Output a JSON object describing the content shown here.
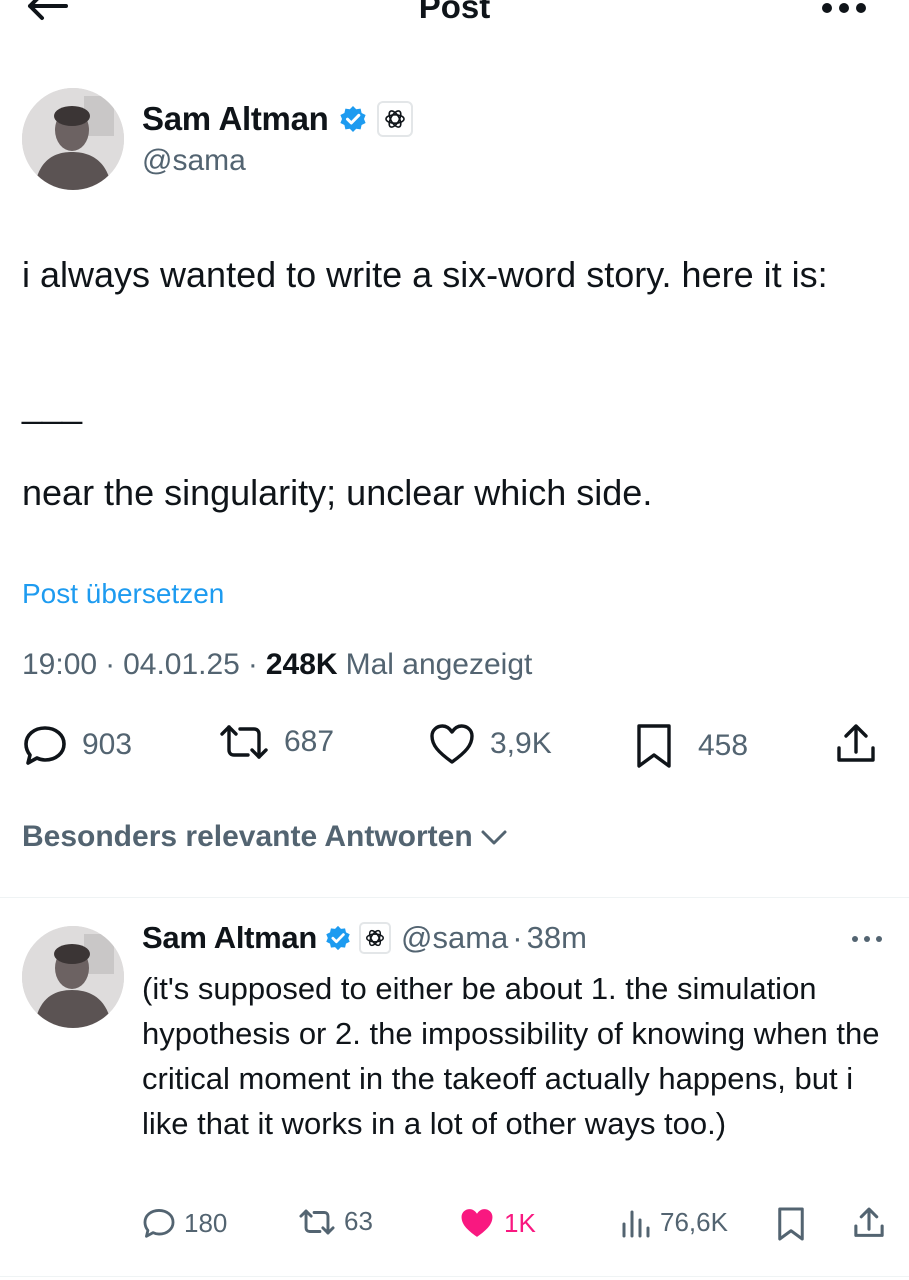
{
  "header": {
    "title": "Post",
    "back_icon": "arrow-left-icon",
    "more_icon": "more-horizontal-icon"
  },
  "post": {
    "author": {
      "name": "Sam Altman",
      "handle": "@sama",
      "verified_icon": "verified-badge-icon",
      "affiliation_icon": "openai-logo-icon"
    },
    "text_line1": "i always wanted to write a six-word story. here it is:",
    "text_line2": "___",
    "text_line3": "near the singularity; unclear which side.",
    "translate_label": "Post übersetzen",
    "time": "19:00",
    "date": "04.01.25",
    "views_count": "248K",
    "views_label": "Mal angezeigt",
    "actions": {
      "replies": "903",
      "reposts": "687",
      "likes": "3,9K",
      "bookmarks": "458"
    }
  },
  "replies_section": {
    "sort_label": "Besonders relevante Antworten"
  },
  "reply": {
    "author": {
      "name": "Sam Altman",
      "handle": "@sama",
      "time": "38m"
    },
    "text": "(it's supposed to either be about 1. the simulation hypothesis or 2. the impossibility of knowing when the critical moment in the takeoff actually happens, but i like that it works in a lot of other ways too.)",
    "actions": {
      "replies": "180",
      "reposts": "63",
      "likes": "1K",
      "views": "76,6K"
    }
  },
  "colors": {
    "accent": "#1d9bf0",
    "muted": "#536471",
    "like": "#f91880",
    "text": "#0f1419"
  }
}
